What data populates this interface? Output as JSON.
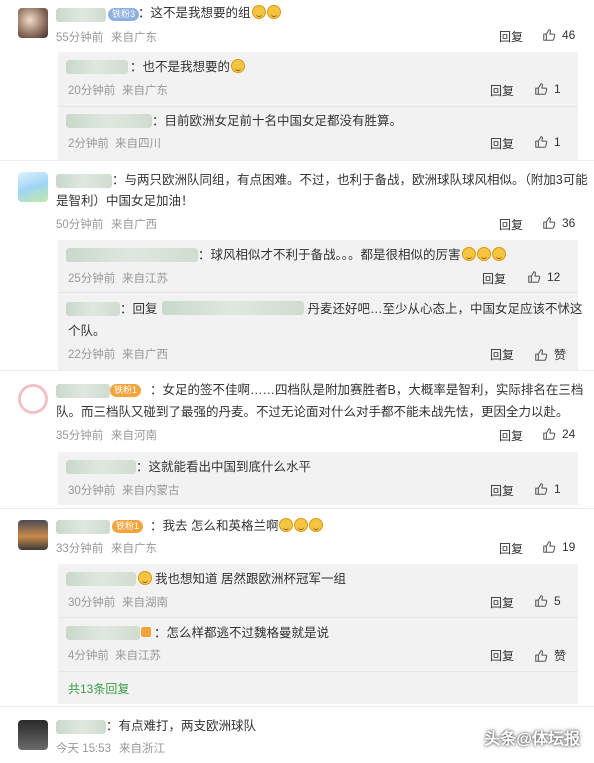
{
  "comments": [
    {
      "badge": "铁粉3",
      "text": "：这不是我想要的组",
      "time": "55分钟前",
      "location": "来自广东",
      "reply_label": "回复",
      "likes": "46",
      "replies": [
        {
          "text": "：也不是我想要的",
          "time": "20分钟前",
          "location": "来自广东",
          "reply_label": "回复",
          "likes": "1"
        },
        {
          "text": "：目前欧洲女足前十名中国女足都没有胜算。",
          "time": "2分钟前",
          "location": "来自四川",
          "reply_label": "回复",
          "likes": "1"
        }
      ]
    },
    {
      "text_line1": "：与两只欧洲队同组，有点困难。不过，也利于备战，欧洲球队球风相似。（附加3可能",
      "text_line2": "是智利）中国女足加油！",
      "time": "50分钟前",
      "location": "来自广西",
      "reply_label": "回复",
      "likes": "36",
      "replies": [
        {
          "text": "：球风相似才不利于备战。。。都是很相似的厉害",
          "time": "25分钟前",
          "location": "来自江苏",
          "reply_label": "回复",
          "likes": "12"
        },
        {
          "text_prefix": "：回复",
          "text_line1": "丹麦还好吧…至少从心态上，中国女足应该不怵这",
          "text_line2": "个队。",
          "time": "22分钟前",
          "location": "来自广西",
          "reply_label": "回复",
          "likes": "赞"
        }
      ]
    },
    {
      "badge": "铁粉1",
      "text_line1": "：女足的签不佳啊……四档队是附加赛胜者B，大概率是智利，实际排名在三档",
      "text_line2": "队。而三档队又碰到了最强的丹麦。不过无论面对什么对手都不能未战先怯，更因全力以赴。",
      "time": "35分钟前",
      "location": "来自河南",
      "reply_label": "回复",
      "likes": "24",
      "replies": [
        {
          "text": "：这就能看出中国到底什么水平",
          "time": "30分钟前",
          "location": "来自内蒙古",
          "reply_label": "回复",
          "likes": "1"
        }
      ]
    },
    {
      "badge": "铁粉1",
      "text": "：我去 怎么和英格兰啊",
      "time": "33分钟前",
      "location": "来自广东",
      "reply_label": "回复",
      "likes": "19",
      "replies": [
        {
          "text": "我也想知道 居然跟欧洲杯冠军一组",
          "time": "30分钟前",
          "location": "来自湖南",
          "reply_label": "回复",
          "likes": "5"
        },
        {
          "text": "：怎么样都逃不过魏格曼就是说",
          "time": "4分钟前",
          "location": "来自江苏",
          "reply_label": "回复",
          "likes": "赞"
        }
      ],
      "more_replies": "共13条回复"
    },
    {
      "text": "：有点难打，两支欧洲球队",
      "time": "今天 15:53",
      "location": "来自浙江"
    }
  ],
  "watermark": "头条@体坛报",
  "colors": {
    "link_green": "#3b9e46",
    "meta_gray": "#999999",
    "reply_bg": "#f2f2f2"
  }
}
